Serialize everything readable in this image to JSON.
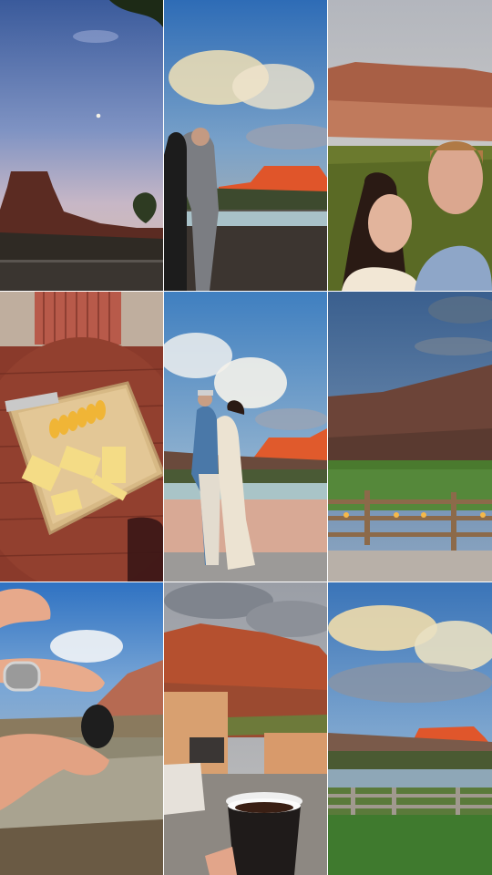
{
  "collage": {
    "tiles": [
      {
        "id": "tile-1",
        "subject": "moon-over-butte",
        "sky_top": "#3c5b9c",
        "sky_bottom": "#c9b8c4"
      },
      {
        "id": "tile-2",
        "subject": "couple-embrace-at-railing",
        "sky_top": "#2f6fb8",
        "accent": "#e0552a"
      },
      {
        "id": "tile-3",
        "subject": "couple-selfie-vineyard",
        "sky_top": "#b9bcc2",
        "accent": "#b56e50"
      },
      {
        "id": "tile-4",
        "subject": "cheese-board-on-table",
        "table_color": "#8c3b2c",
        "accent": "#f1d27a"
      },
      {
        "id": "tile-5",
        "subject": "couple-dancing-at-railing",
        "sky_top": "#4a86c4",
        "accent": "#e05a2c"
      },
      {
        "id": "tile-6",
        "subject": "fence-lights-at-dusk",
        "sky_top": "#3d6390",
        "accent": "#f2b24a"
      },
      {
        "id": "tile-7",
        "subject": "hand-holding-stone-by-river",
        "sky_top": "#2f72c2",
        "accent": "#1f1f1f"
      },
      {
        "id": "tile-8",
        "subject": "coffee-cup-on-patio",
        "sky_top": "#9a9ea6",
        "accent": "#b5502f"
      },
      {
        "id": "tile-9",
        "subject": "sunset-clouds-over-river",
        "sky_top": "#3a74b8",
        "accent": "#e0562b"
      }
    ]
  }
}
